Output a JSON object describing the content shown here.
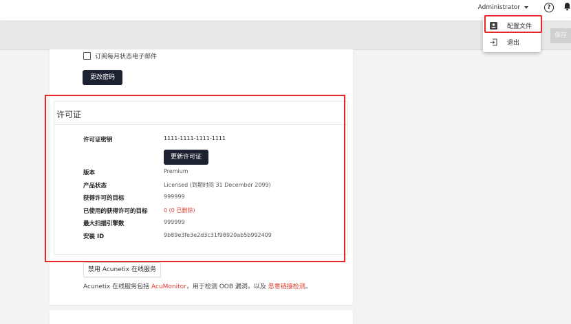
{
  "header": {
    "user": "Administrator",
    "help_icon": "?"
  },
  "toolbar": {
    "save_label": "保存"
  },
  "account": {
    "subscribe_label": "订阅每月状态电子邮件",
    "change_password": "更改密码"
  },
  "license": {
    "title": "许可证",
    "key_label": "许可证密钥",
    "key_value": "1111-1111-1111-1111",
    "renew_button": "更新许可证",
    "edition_label": "版本",
    "edition_value": "Premium",
    "status_label": "产品状态",
    "status_value": "Licensed (到期时间 31 December 2099)",
    "licensed_targets_label": "获得许可的目标",
    "licensed_targets_value": "999999",
    "used_targets_label": "已使用的获得许可的目标",
    "used_targets_value": "0 (0 已删除)",
    "max_engines_label": "最大扫描引擎数",
    "max_engines_value": "999999",
    "install_id_label": "安装 ID",
    "install_id_value": "9b89e3fe3e2d3c31f98920ab5b992409"
  },
  "online_services": {
    "disable_button": "禁用 Acunetix 在线服务",
    "note_prefix": "Acunetix 在线服务包括 ",
    "note_link1": "AcuMonitor",
    "note_middle": "，用于检测 OOB 漏洞，以及 ",
    "note_link2": "恶意链接检测",
    "note_suffix": "。"
  },
  "dropdown": {
    "profile_label": "配置文件",
    "logout_label": "退出"
  },
  "colors": {
    "accent_red": "#e8262a",
    "dark_button": "#1d2230"
  }
}
